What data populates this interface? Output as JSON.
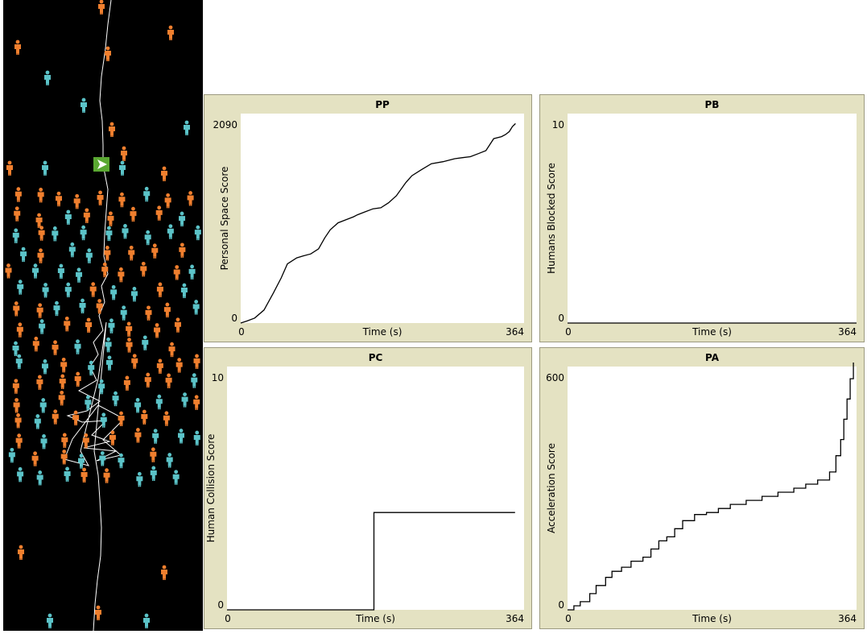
{
  "colors": {
    "panel_bg": "#e4e2c2",
    "panel_border": "#9c9a80",
    "plot_bg": "#ffffff",
    "line": "#000000",
    "world_bg": "#000000",
    "agent_orange": "#f07f2e",
    "agent_cyan": "#5bc3c8",
    "robot_green": "#5aa832",
    "trail": "#ffffff"
  },
  "world": {
    "icons": {
      "agent": "person-icon",
      "robot": "arrow-icon"
    },
    "trail_top": [
      [
        134,
        0
      ],
      [
        130,
        30
      ],
      [
        127,
        60
      ],
      [
        122,
        95
      ],
      [
        120,
        125
      ],
      [
        123,
        150
      ],
      [
        124,
        180
      ],
      [
        124,
        204
      ]
    ],
    "trail_bottom": [
      [
        113,
        560
      ],
      [
        118,
        590
      ],
      [
        120,
        620
      ],
      [
        122,
        655
      ],
      [
        121,
        690
      ],
      [
        117,
        720
      ],
      [
        114,
        750
      ],
      [
        112,
        783
      ]
    ],
    "tangle": [
      [
        124,
        204
      ],
      [
        130,
        235
      ],
      [
        128,
        262
      ],
      [
        126,
        290
      ],
      [
        125,
        318
      ],
      [
        130,
        340
      ],
      [
        122,
        355
      ],
      [
        126,
        375
      ],
      [
        119,
        392
      ],
      [
        124,
        410
      ],
      [
        112,
        425
      ],
      [
        118,
        440
      ],
      [
        108,
        455
      ],
      [
        116,
        472
      ],
      [
        94,
        485
      ],
      [
        120,
        498
      ],
      [
        104,
        510
      ],
      [
        80,
        516
      ],
      [
        98,
        524
      ],
      [
        128,
        522
      ],
      [
        110,
        540
      ],
      [
        132,
        548
      ],
      [
        100,
        556
      ],
      [
        140,
        560
      ],
      [
        116,
        572
      ],
      [
        146,
        565
      ],
      [
        124,
        546
      ],
      [
        150,
        520
      ],
      [
        118,
        503
      ],
      [
        86,
        545
      ],
      [
        76,
        570
      ],
      [
        106,
        578
      ],
      [
        96,
        560
      ],
      [
        118,
        470
      ],
      [
        128,
        400
      ],
      [
        113,
        560
      ]
    ]
  },
  "chart_data": [
    {
      "type": "line",
      "title": "PP",
      "ylabel": "Personal Space Score",
      "xlabel": "Time (s)",
      "xlim": [
        0,
        364
      ],
      "ylim": [
        0,
        2090
      ],
      "x_tick_labels": [
        "0",
        "364"
      ],
      "y_tick_labels": [
        "0",
        "2090"
      ],
      "step": false,
      "series": [
        {
          "x": [
            0,
            8,
            18,
            30,
            42,
            52,
            60,
            72,
            80,
            90,
            100,
            108,
            115,
            125,
            135,
            145,
            150,
            160,
            170,
            180,
            190,
            200,
            212,
            220,
            232,
            245,
            260,
            275,
            285,
            295,
            305,
            315,
            325,
            335,
            340,
            345,
            349,
            353
          ],
          "y": [
            0,
            20,
            50,
            130,
            300,
            450,
            590,
            650,
            670,
            690,
            740,
            850,
            930,
            1000,
            1030,
            1060,
            1080,
            1110,
            1140,
            1150,
            1200,
            1270,
            1400,
            1470,
            1530,
            1590,
            1610,
            1640,
            1650,
            1660,
            1690,
            1720,
            1840,
            1860,
            1880,
            1910,
            1960,
            1990
          ]
        }
      ]
    },
    {
      "type": "line",
      "title": "PB",
      "ylabel": "Humans Blocked Score",
      "xlabel": "Time (s)",
      "xlim": [
        0,
        364
      ],
      "ylim": [
        0,
        10
      ],
      "x_tick_labels": [
        "0",
        "364"
      ],
      "y_tick_labels": [
        "0",
        "10"
      ],
      "step": false,
      "series": [
        {
          "x": [
            0,
            364
          ],
          "y": [
            0,
            0
          ]
        }
      ]
    },
    {
      "type": "line",
      "title": "PC",
      "ylabel": "Human Collision Score",
      "xlabel": "Time (s)",
      "xlim": [
        0,
        364
      ],
      "ylim": [
        0,
        10
      ],
      "x_tick_labels": [
        "0",
        "364"
      ],
      "y_tick_labels": [
        "0",
        "10"
      ],
      "step": true,
      "series": [
        {
          "x": [
            0,
            180,
            180,
            353
          ],
          "y": [
            0,
            0,
            4,
            4
          ]
        }
      ]
    },
    {
      "type": "line",
      "title": "PA",
      "ylabel": "Acceleration Score",
      "xlabel": "Time (s)",
      "xlim": [
        0,
        364
      ],
      "ylim": [
        0,
        600
      ],
      "x_tick_labels": [
        "0",
        "364"
      ],
      "y_tick_labels": [
        "0",
        "600"
      ],
      "step": true,
      "series": [
        {
          "x": [
            0,
            8,
            16,
            28,
            36,
            48,
            56,
            68,
            80,
            95,
            105,
            115,
            125,
            135,
            145,
            160,
            175,
            190,
            205,
            225,
            245,
            265,
            285,
            300,
            315,
            330,
            338,
            344,
            348,
            352,
            356,
            360
          ],
          "y": [
            0,
            10,
            20,
            40,
            60,
            80,
            95,
            105,
            120,
            130,
            150,
            170,
            180,
            200,
            220,
            235,
            240,
            250,
            260,
            270,
            280,
            290,
            300,
            310,
            320,
            340,
            380,
            420,
            470,
            520,
            570,
            610
          ]
        }
      ]
    }
  ]
}
